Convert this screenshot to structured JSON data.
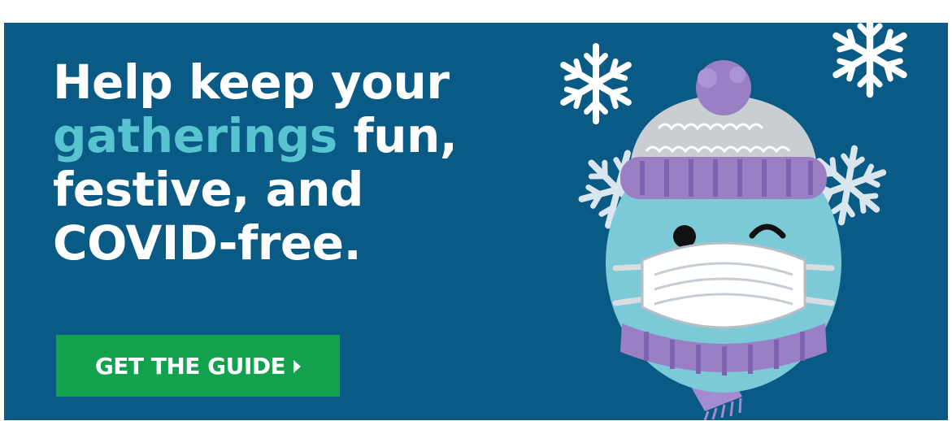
{
  "banner": {
    "headline_line1": "Help keep your",
    "headline_accent": "gatherings",
    "headline_line2_rest": " fun,",
    "headline_line3": "festive, and",
    "headline_line4": "COVID-free.",
    "cta_label": "GET THE GUIDE",
    "icons": [
      "snowflake-icon",
      "masked-emoji-illustration",
      "caret-right-icon"
    ]
  },
  "colors": {
    "banner_bg": "#0a5a86",
    "accent_text": "#58c4cf",
    "cta_bg": "#12a14d",
    "hat_purple": "#9b7fc4",
    "face_blue": "#7cc9d8"
  }
}
